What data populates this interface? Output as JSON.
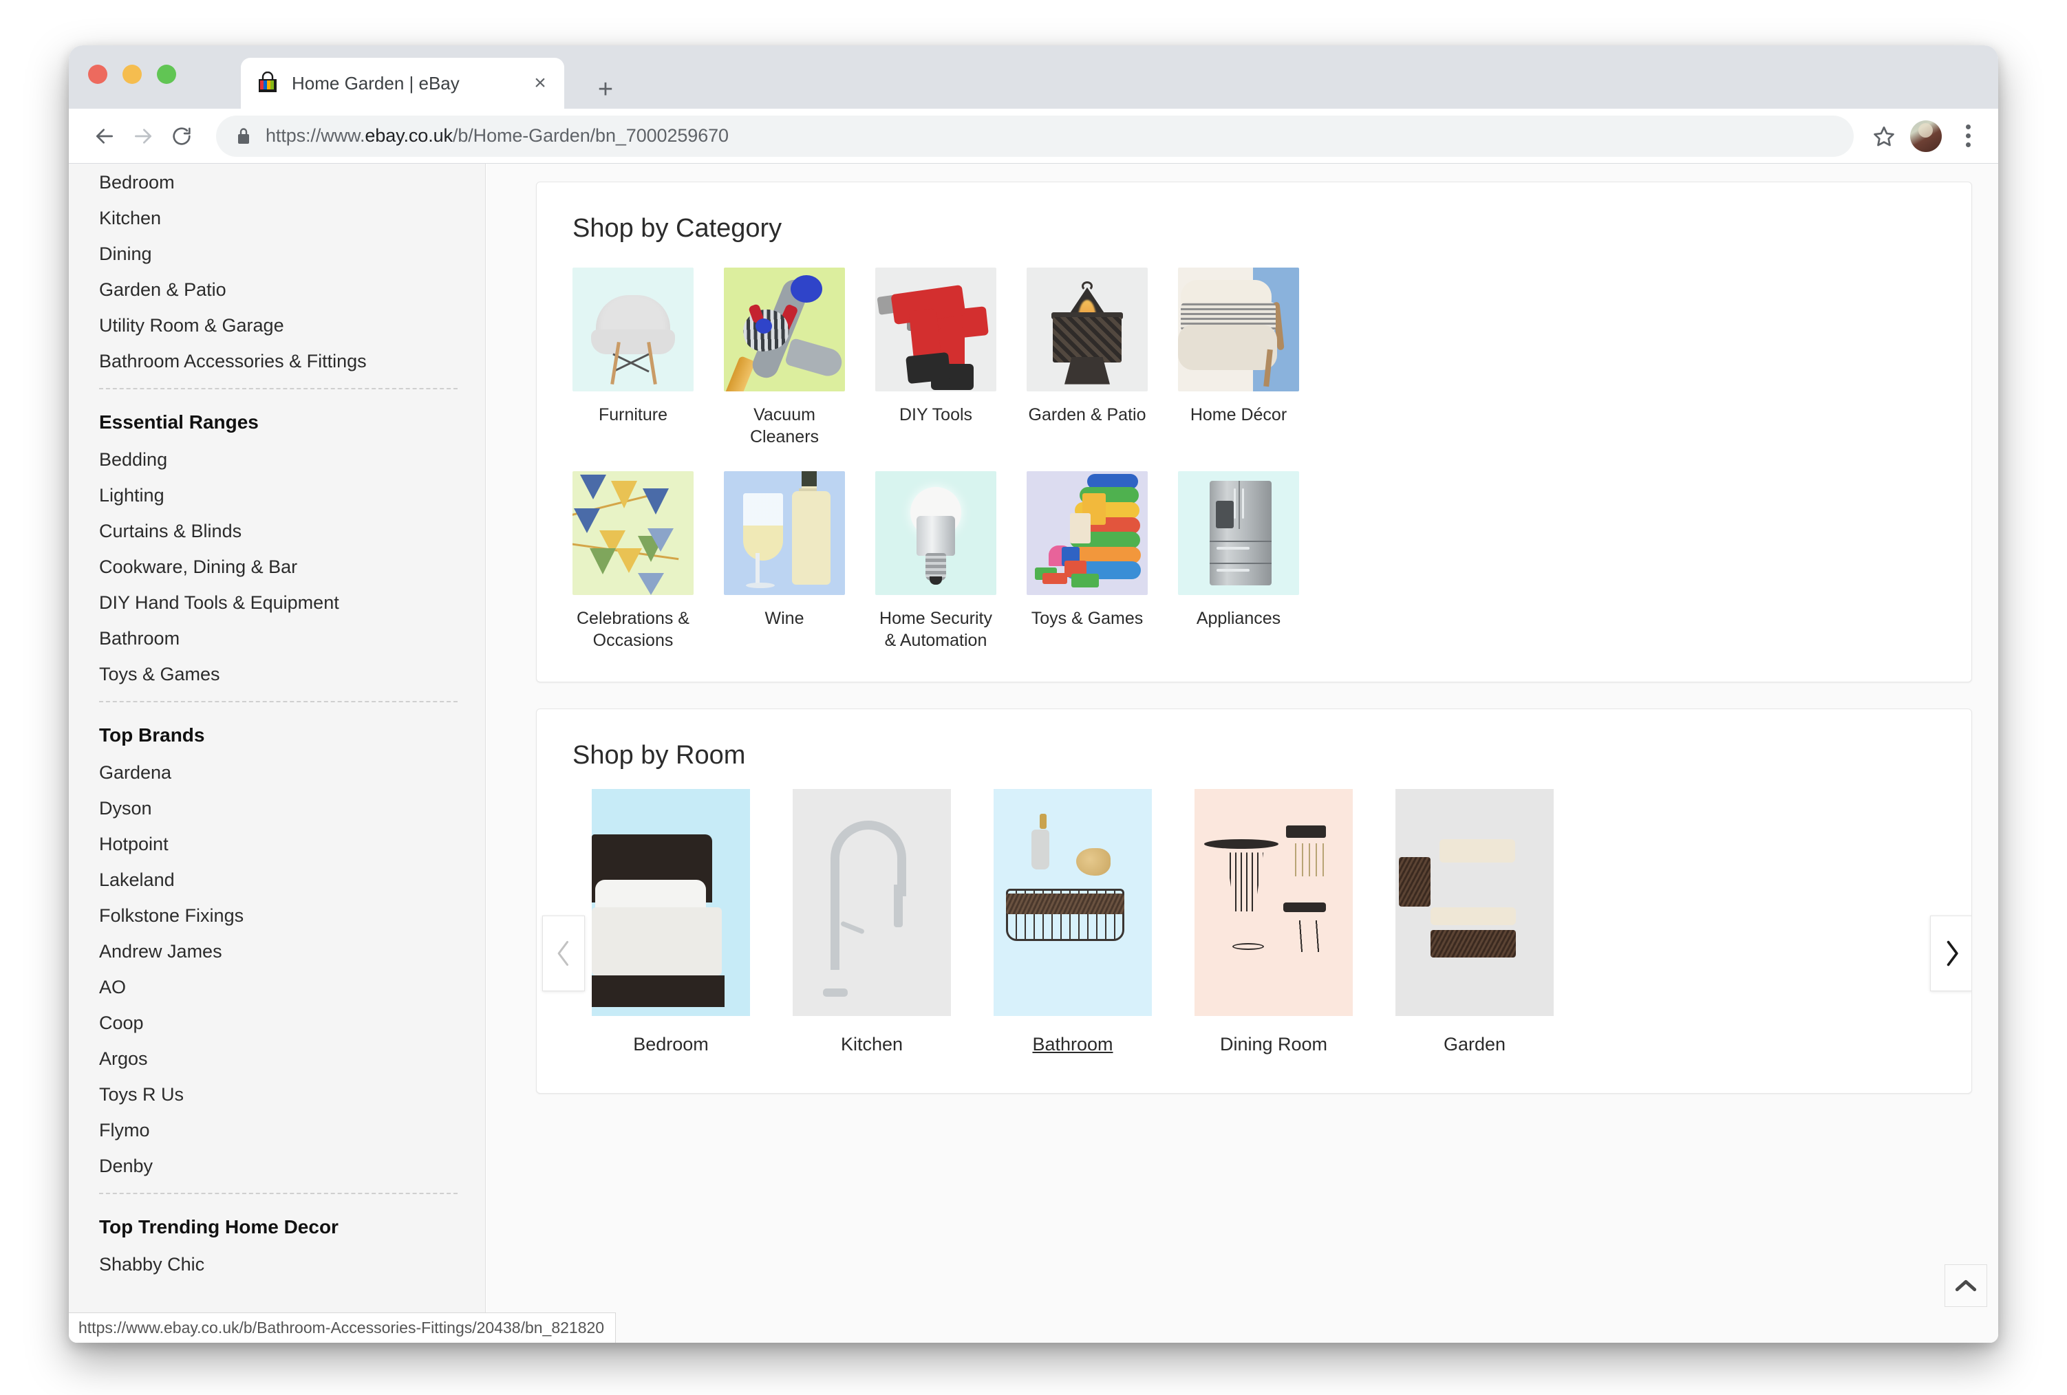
{
  "browser": {
    "tab": {
      "title": "Home Garden | eBay",
      "favicon": "ebay-bag-icon",
      "close_label": "×"
    },
    "new_tab_label": "+",
    "url_scheme": "https://www.",
    "url_host": "ebay.co.uk",
    "url_path": "/b/Home-Garden/bn_7000259670",
    "url_full": "https://www.ebay.co.uk/b/Home-Garden/bn_7000259670",
    "status_link": "https://www.ebay.co.uk/b/Bathroom-Accessories-Fittings/20438/bn_821820",
    "icons": {
      "back": "back-arrow-icon",
      "forward": "forward-arrow-icon",
      "reload": "reload-icon",
      "lock": "lock-icon",
      "star": "bookmark-star-icon",
      "avatar": "profile-avatar",
      "menu": "three-dot-menu-icon"
    }
  },
  "sidebar": {
    "top_links": [
      "Bedroom",
      "Kitchen",
      "Dining",
      "Garden & Patio",
      "Utility Room & Garage",
      "Bathroom Accessories & Fittings"
    ],
    "essential_ranges_heading": "Essential Ranges",
    "essential_ranges": [
      "Bedding",
      "Lighting",
      "Curtains & Blinds",
      "Cookware, Dining & Bar",
      "DIY Hand Tools & Equipment",
      "Bathroom",
      "Toys & Games"
    ],
    "top_brands_heading": "Top Brands",
    "top_brands": [
      "Gardena",
      "Dyson",
      "Hotpoint",
      "Lakeland",
      "Folkstone Fixings",
      "Andrew James",
      "AO",
      "Coop",
      "Argos",
      "Toys R Us",
      "Flymo",
      "Denby"
    ],
    "top_trending_heading": "Top Trending Home Decor",
    "top_trending": [
      "Shabby Chic"
    ]
  },
  "category_section": {
    "title": "Shop by Category",
    "rows": [
      [
        {
          "label": "Furniture",
          "art": "furniture"
        },
        {
          "label": "Vacuum Cleaners",
          "art": "vacuum"
        },
        {
          "label": "DIY Tools",
          "art": "diy"
        },
        {
          "label": "Garden & Patio",
          "art": "firepit"
        },
        {
          "label": "Home Décor",
          "art": "decor"
        }
      ],
      [
        {
          "label": "Celebrations & Occasions",
          "art": "bunting"
        },
        {
          "label": "Wine",
          "art": "wine"
        },
        {
          "label": "Home Security & Automation",
          "art": "bulb"
        },
        {
          "label": "Toys & Games",
          "art": "toys"
        },
        {
          "label": "Appliances",
          "art": "fridge"
        }
      ]
    ]
  },
  "room_section": {
    "title": "Shop by Room",
    "prev_label": "‹",
    "next_label": "›",
    "cards": [
      {
        "label": "Bedroom",
        "art": "bedroom",
        "hovered": false
      },
      {
        "label": "Kitchen",
        "art": "kitchen",
        "hovered": false
      },
      {
        "label": "Bathroom",
        "art": "bathroom",
        "hovered": true
      },
      {
        "label": "Dining Room",
        "art": "dining",
        "hovered": false
      },
      {
        "label": "Garden",
        "art": "garden",
        "hovered": false
      }
    ]
  },
  "back_to_top": {
    "icon": "chevron-up-icon"
  },
  "colors": {
    "sidebar_bg": "#f5f5f5",
    "page_bg": "#fafafa",
    "panel_bg": "#ffffff",
    "text": "#2b2b2b",
    "chrome_tabstrip": "#dee1e6"
  }
}
